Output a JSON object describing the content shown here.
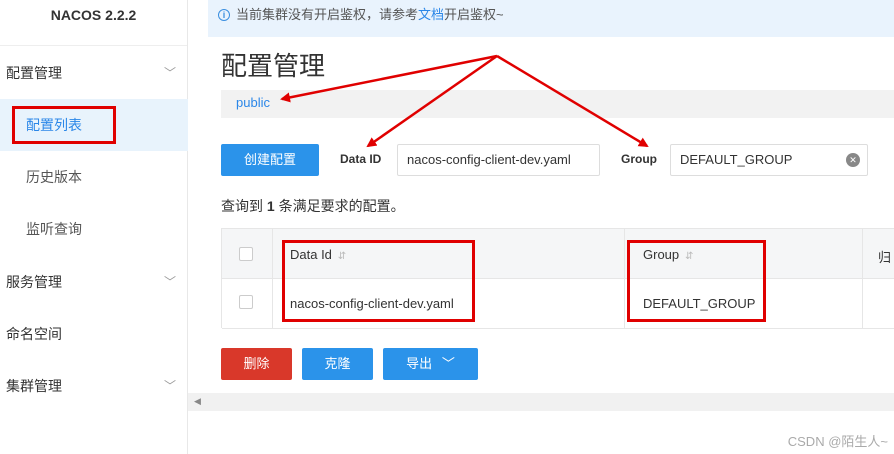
{
  "app": {
    "title": "NACOS 2.2.2"
  },
  "sidebar": {
    "items": [
      {
        "label": "配置管理",
        "expanded": true
      },
      {
        "label": "配置列表",
        "active": true
      },
      {
        "label": "历史版本"
      },
      {
        "label": "监听查询"
      },
      {
        "label": "服务管理",
        "expanded": false
      },
      {
        "label": "命名空间"
      },
      {
        "label": "集群管理",
        "expanded": false
      }
    ]
  },
  "notice": {
    "prefix": "当前集群没有开启鉴权，请参考",
    "link": "文档",
    "suffix": "开启鉴权~"
  },
  "page": {
    "title": "配置管理",
    "namespace": "public"
  },
  "toolbar": {
    "create_label": "创建配置",
    "dataid_label": "Data ID",
    "dataid_value": "nacos-config-client-dev.yaml",
    "group_label": "Group",
    "group_value": "DEFAULT_GROUP"
  },
  "result": {
    "prefix": "查询到",
    "count": "1",
    "suffix": "条满足要求的配置。"
  },
  "table": {
    "headers": [
      "Data Id",
      "Group",
      "归"
    ],
    "rows": [
      {
        "data_id": "nacos-config-client-dev.yaml",
        "group": "DEFAULT_GROUP"
      }
    ]
  },
  "actions": {
    "delete": "删除",
    "clone": "克隆",
    "export": "导出"
  },
  "watermark": "CSDN @陌生人~",
  "colors": {
    "accent": "#2b93ea",
    "danger": "#d9382a",
    "annotation": "#e00000"
  }
}
